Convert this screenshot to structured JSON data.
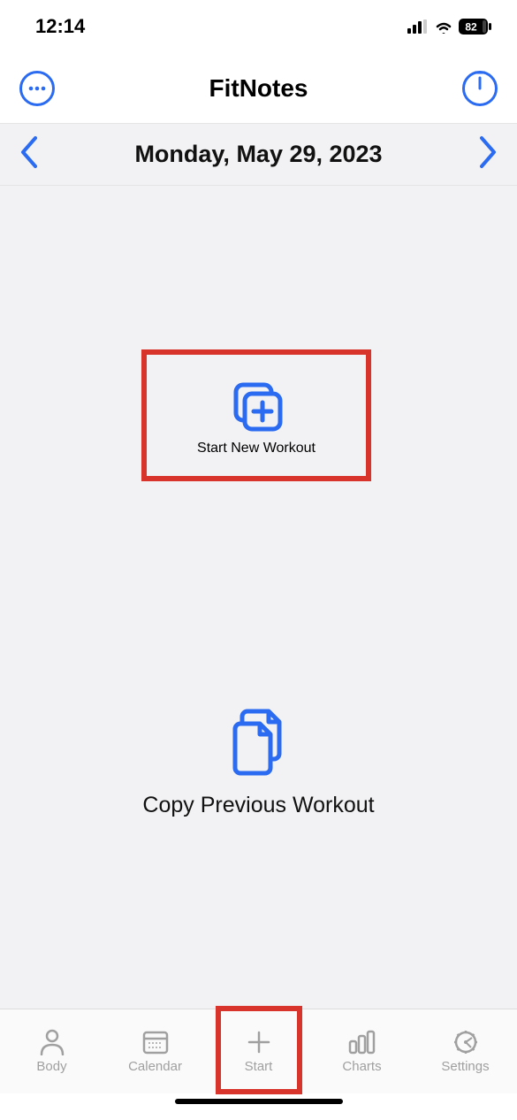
{
  "status": {
    "time": "12:14",
    "battery": "82"
  },
  "navbar": {
    "title": "FitNotes"
  },
  "datebar": {
    "date": "Monday, May 29, 2023"
  },
  "actions": {
    "new_workout": "Start New Workout",
    "copy_workout": "Copy Previous Workout"
  },
  "tabs": {
    "body": "Body",
    "calendar": "Calendar",
    "start": "Start",
    "charts": "Charts",
    "settings": "Settings"
  }
}
